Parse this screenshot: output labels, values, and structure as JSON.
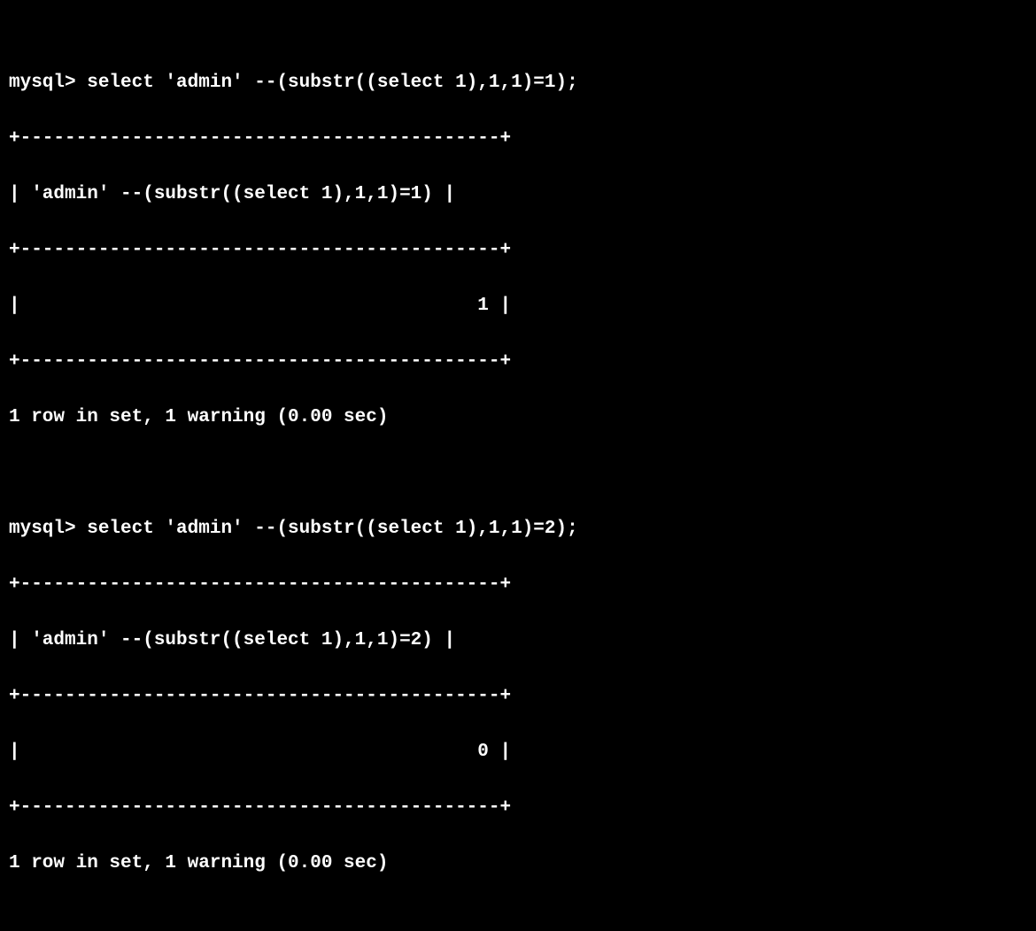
{
  "terminal": {
    "prompt": "mysql> ",
    "query1": {
      "command": "select 'admin' --(substr((select 1),1,1)=1);",
      "border_top": "+-------------------------------------------+",
      "header": "| 'admin' --(substr((select 1),1,1)=1) |",
      "border_mid": "+-------------------------------------------+",
      "value_row": "|                                         1 |",
      "border_bot": "+-------------------------------------------+",
      "status": "1 row in set, 1 warning (0.00 sec)"
    },
    "query2": {
      "command": "select 'admin' --(substr((select 1),1,1)=2);",
      "border_top": "+-------------------------------------------+",
      "header": "| 'admin' --(substr((select 1),1,1)=2) |",
      "border_mid": "+-------------------------------------------+",
      "value_row": "|                                         0 |",
      "border_bot": "+-------------------------------------------+",
      "status": "1 row in set, 1 warning (0.00 sec)"
    }
  }
}
